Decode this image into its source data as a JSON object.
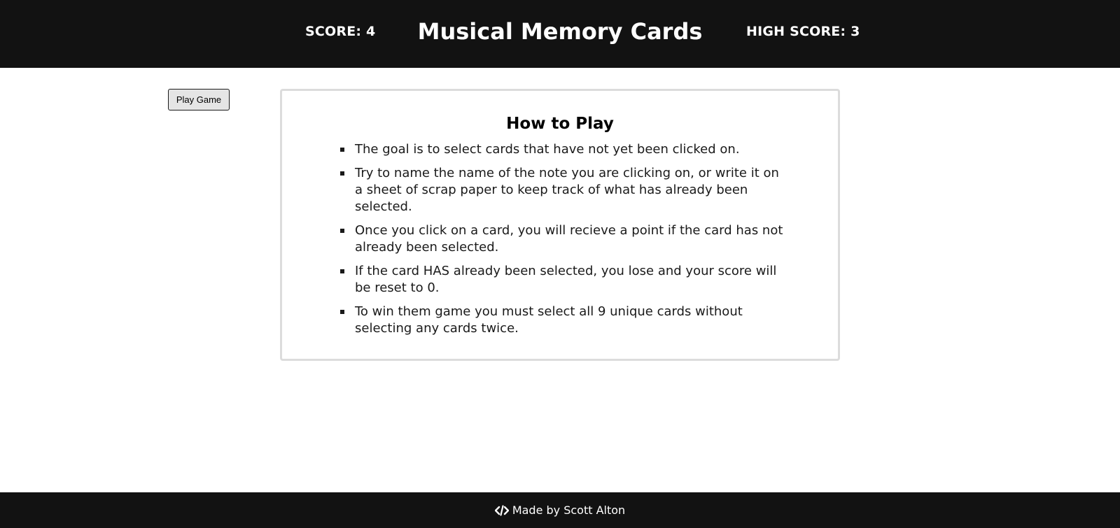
{
  "header": {
    "score_label": "SCORE: 4",
    "title": "Musical Memory Cards",
    "high_score_label": "HIGH SCORE: 3"
  },
  "controls": {
    "play_button_label": "Play Game"
  },
  "instructions": {
    "title": "How to Play",
    "rules": [
      "The goal is to select cards that have not yet been clicked on.",
      "Try to name the name of the note you are clicking on, or write it on a sheet of scrap paper to keep track of what has already been selected.",
      "Once you click on a card, you will recieve a point if the card has not already been selected.",
      "If the card HAS already been selected, you lose and your score will be reset to 0.",
      "To win them game you must select all 9 unique cards without selecting any cards twice."
    ]
  },
  "footer": {
    "icon": "code-icon",
    "credit": "Made by Scott Alton"
  },
  "colors": {
    "bar_background": "#121212",
    "card_border": "#dcdcdc",
    "button_background": "#e5e5e5"
  }
}
